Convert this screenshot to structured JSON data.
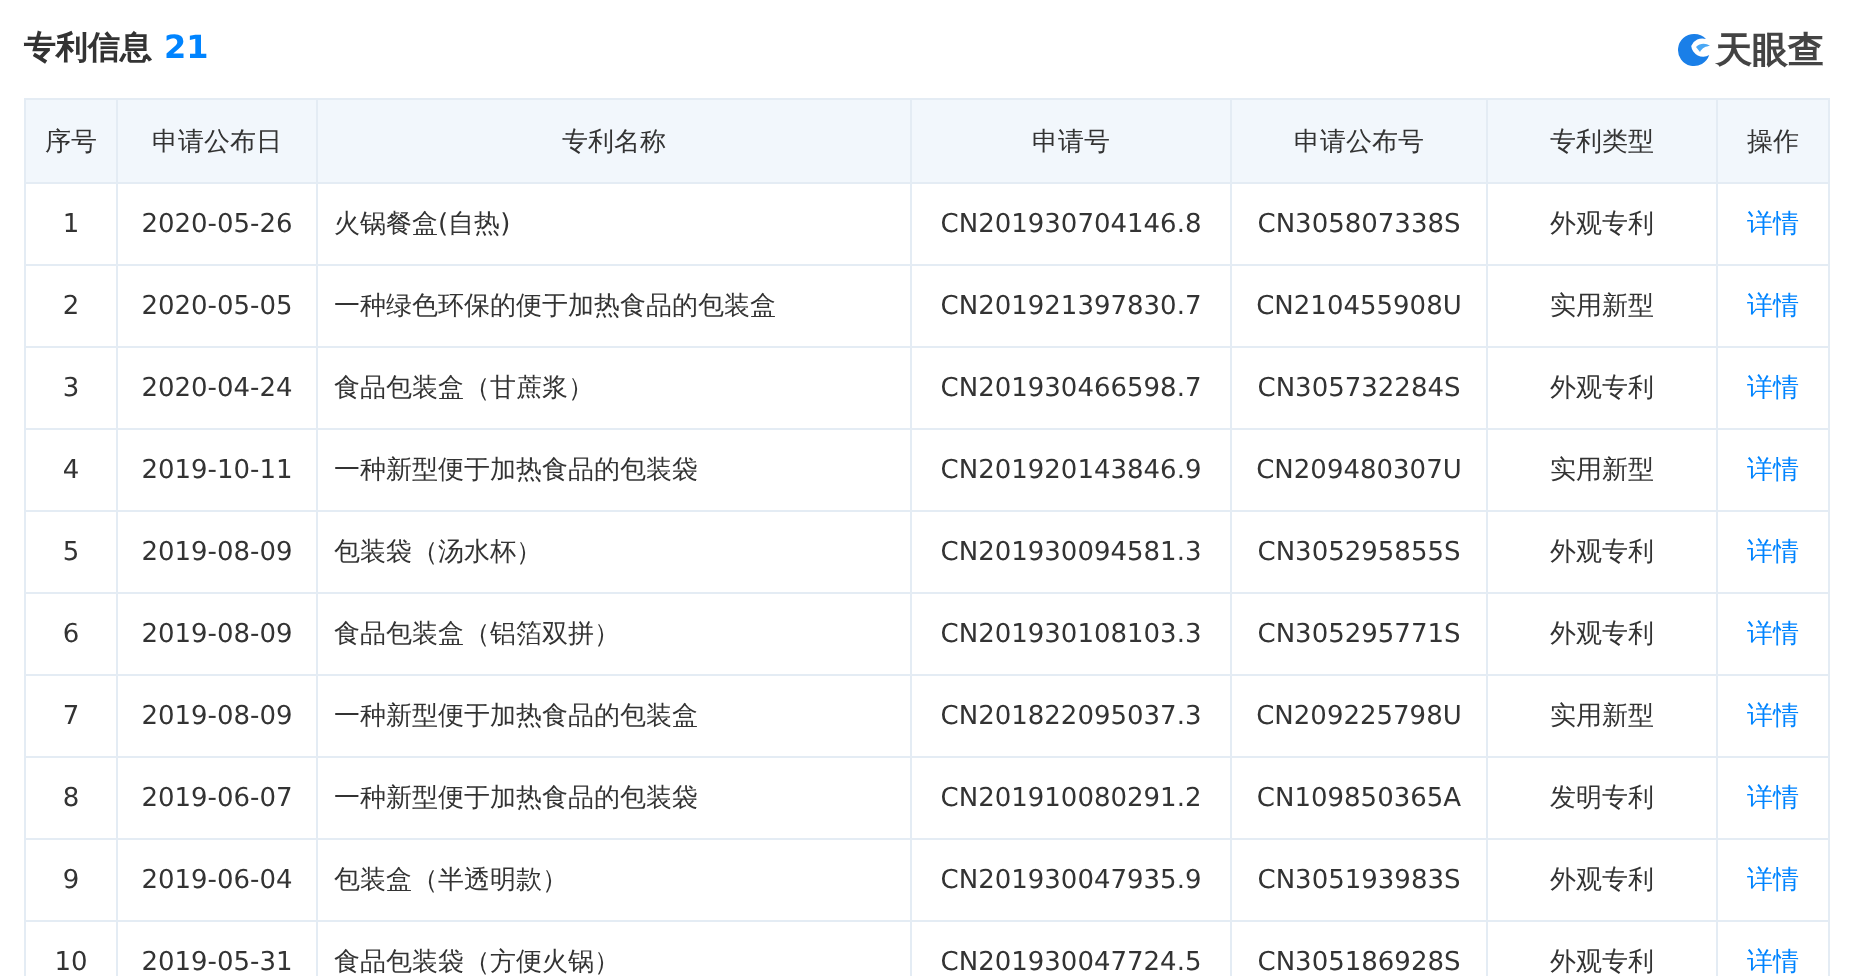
{
  "header": {
    "title": "专利信息",
    "count": "21",
    "logo_text": "天眼查"
  },
  "table": {
    "columns": [
      "序号",
      "申请公布日",
      "专利名称",
      "申请号",
      "申请公布号",
      "专利类型",
      "操作"
    ],
    "rows": [
      {
        "index": "1",
        "date": "2020-05-26",
        "name": "火锅餐盒(自热)",
        "app_no": "CN201930704146.8",
        "pub_no": "CN305807338S",
        "type": "外观专利",
        "action": "详情"
      },
      {
        "index": "2",
        "date": "2020-05-05",
        "name": "一种绿色环保的便于加热食品的包装盒",
        "app_no": "CN201921397830.7",
        "pub_no": "CN210455908U",
        "type": "实用新型",
        "action": "详情"
      },
      {
        "index": "3",
        "date": "2020-04-24",
        "name": "食品包装盒（甘蔗浆）",
        "app_no": "CN201930466598.7",
        "pub_no": "CN305732284S",
        "type": "外观专利",
        "action": "详情"
      },
      {
        "index": "4",
        "date": "2019-10-11",
        "name": "一种新型便于加热食品的包装袋",
        "app_no": "CN201920143846.9",
        "pub_no": "CN209480307U",
        "type": "实用新型",
        "action": "详情"
      },
      {
        "index": "5",
        "date": "2019-08-09",
        "name": "包装袋（汤水杯）",
        "app_no": "CN201930094581.3",
        "pub_no": "CN305295855S",
        "type": "外观专利",
        "action": "详情"
      },
      {
        "index": "6",
        "date": "2019-08-09",
        "name": "食品包装盒（铝箔双拼）",
        "app_no": "CN201930108103.3",
        "pub_no": "CN305295771S",
        "type": "外观专利",
        "action": "详情"
      },
      {
        "index": "7",
        "date": "2019-08-09",
        "name": "一种新型便于加热食品的包装盒",
        "app_no": "CN201822095037.3",
        "pub_no": "CN209225798U",
        "type": "实用新型",
        "action": "详情"
      },
      {
        "index": "8",
        "date": "2019-06-07",
        "name": "一种新型便于加热食品的包装袋",
        "app_no": "CN201910080291.2",
        "pub_no": "CN109850365A",
        "type": "发明专利",
        "action": "详情"
      },
      {
        "index": "9",
        "date": "2019-06-04",
        "name": "包装盒（半透明款）",
        "app_no": "CN201930047935.9",
        "pub_no": "CN305193983S",
        "type": "外观专利",
        "action": "详情"
      },
      {
        "index": "10",
        "date": "2019-05-31",
        "name": "食品包装袋（方便火锅）",
        "app_no": "CN201930047724.5",
        "pub_no": "CN305186928S",
        "type": "外观专利",
        "action": "详情"
      }
    ]
  }
}
